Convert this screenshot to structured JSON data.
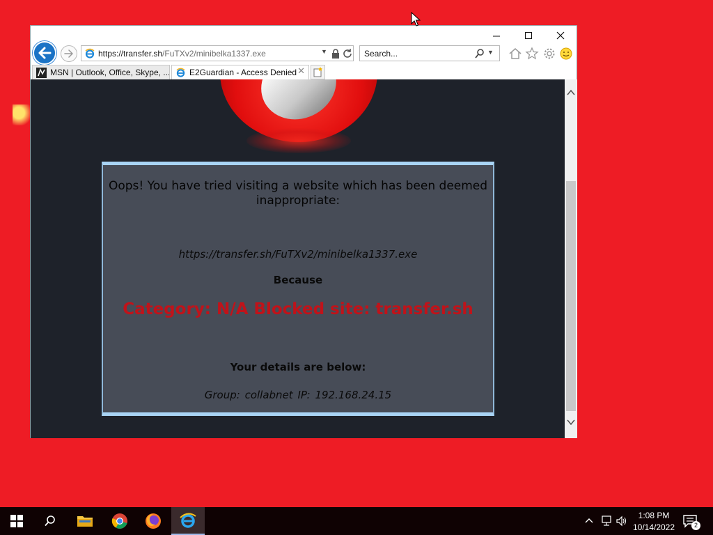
{
  "browser": {
    "address": {
      "host": "https://transfer.sh",
      "path": "/FuTXv2/minibelka1337.exe"
    },
    "search": {
      "placeholder": "Search..."
    },
    "tabs": [
      {
        "label": "MSN | Outlook, Office, Skype, ...",
        "active": false
      },
      {
        "label": "E2Guardian - Access Denied",
        "active": true
      }
    ]
  },
  "page": {
    "title": "Oops! You have tried visiting a website which has been deemed inappropriate:",
    "blocked_url": "https://transfer.sh/FuTXv2/minibelka1337.exe",
    "because_label": "Because",
    "reason": "Category: N/A  Blocked site: transfer.sh",
    "details_heading": "Your details are below:",
    "group_ip": "Group: collabnet   IP: 192.168.24.15"
  },
  "taskbar": {
    "time": "1:08 PM",
    "date": "10/14/2022",
    "notification_count": "2"
  },
  "colors": {
    "desktop": "#ee1c25",
    "reason_text": "#c0131a",
    "panel": "#474c57",
    "page_bg": "#1e222a"
  }
}
